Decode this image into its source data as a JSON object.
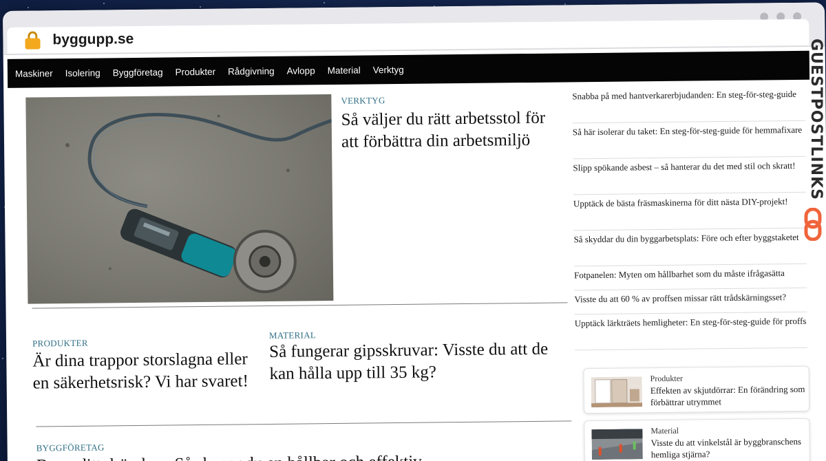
{
  "browser": {
    "url": "byggupp.se"
  },
  "nav": {
    "items": [
      "Maskiner",
      "Isolering",
      "Byggföretag",
      "Produkter",
      "Rådgivning",
      "Avlopp",
      "Material",
      "Verktyg"
    ]
  },
  "hero": {
    "category": "VERKTYG",
    "title": "Så väljer du rätt arbetsstol för att förbättra din arbetsmiljö",
    "image_icon": "angle-grinder-photo"
  },
  "articles": [
    {
      "category": "PRODUKTER",
      "title": "Är dina trappor storslagna eller en säkerhetsrisk? Vi har svaret!"
    },
    {
      "category": "MATERIAL",
      "title": "Så fungerar gipsskruvar: Visste du att de kan hålla upp till 35 kg?"
    },
    {
      "category": "BYGGFÖRETAG",
      "title": "Bygg ditt drömhus: Så skapar du en hållbar och effektiv"
    }
  ],
  "sidebar": {
    "links": [
      "Snabba på med hantverkarerbjudanden: En steg-för-steg-guide",
      "Så här isolerar du taket: En steg-för-steg-guide för hemmafixare",
      "Slipp spökande asbest – så hanterar du det med stil och skratt!",
      "Upptäck de bästa fräsmaskinerna för ditt nästa DIY-projekt!",
      "Så skyddar du din byggarbetsplats: Före och efter byggstaketet",
      "Fotpanelen: Myten om hållbarhet som du måste ifrågasätta",
      "Visste du att 60 % av proffsen missar rätt trådskärningsset?",
      "Upptäck lärkträets hemligheter: En steg-för-steg-guide för proffs"
    ],
    "cards": [
      {
        "category": "Produkter",
        "title": "Effekten av skjutdörrar: En förändring som förbättrar utrymmet",
        "thumb_icon": "sliding-door-photo"
      },
      {
        "category": "Material",
        "title": "Visste du att vinkelstål är byggbranschens hemliga stjärna?",
        "thumb_icon": "construction-site-photo"
      }
    ]
  },
  "watermark": {
    "text": "GUESTPOSTLINKS",
    "icon": "chain-link-icon",
    "accent": "#f0643c"
  }
}
